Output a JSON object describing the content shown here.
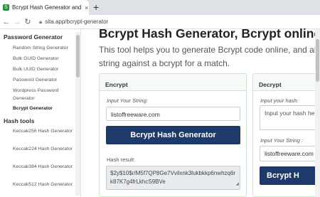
{
  "browser": {
    "tab_title": "Bcrypt Hash Generator and chec",
    "tab_close": "×",
    "new_tab": "+",
    "url": "sita.app/bcrypt-generator"
  },
  "sidebar": {
    "sections": [
      {
        "title": "Password Generator",
        "items": [
          {
            "label": "Random String Generator",
            "active": false
          },
          {
            "label": "Bulk GUID Generator",
            "active": false
          },
          {
            "label": "Bulk UUID Generator",
            "active": false
          },
          {
            "label": "Password Generator",
            "active": false
          },
          {
            "label": "Wordpress Password Generator",
            "active": false
          },
          {
            "label": "Bcrypt Generator",
            "active": true
          }
        ]
      },
      {
        "title": "Hash tools",
        "items": [
          {
            "label": "Keccak256 Hash Generator",
            "active": false
          },
          {
            "label": "Keccak224 Hash Generator",
            "active": false
          },
          {
            "label": "Keccak384 Hash Generator",
            "active": false
          },
          {
            "label": "Keccak512 Hash Generator",
            "active": false
          }
        ]
      }
    ]
  },
  "main": {
    "title": "Bcrypt Hash Generator, Bcrypt online",
    "description": "This tool helps you to generate Bcrypt code online, and also string against a bcrypt for a match.",
    "encrypt": {
      "header": "Encrypt",
      "input_label": "Input Your String:",
      "input_value": "listoffreeware.com",
      "button": "Bcrypt Hash Generator",
      "result_label": "Hash result:",
      "result_value": "$2y$10$r/M5f7QP8Ge7Vvilxnk3lukbkkp6nwhzq6rk87K7g4frLkhcS9BVe"
    },
    "decrypt": {
      "header": "Decrypt",
      "hash_label": "Input your hash:",
      "hash_placeholder": "Input your hash here...",
      "string_label": "Input Your String :",
      "string_value": "listoffreeware.com",
      "button": "Bcrypt H"
    }
  }
}
